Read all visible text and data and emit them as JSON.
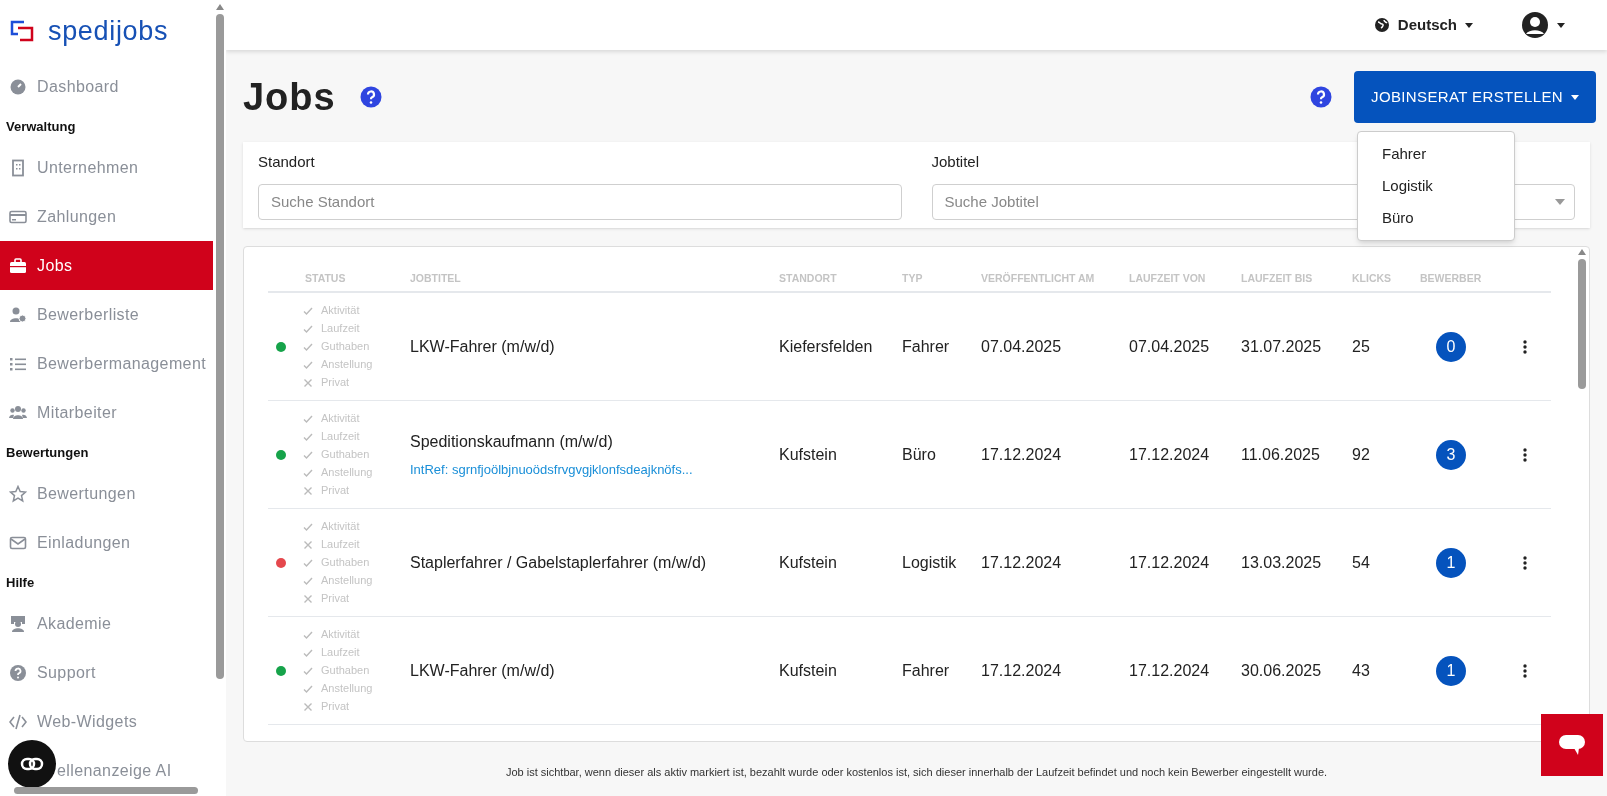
{
  "logo": {
    "text": "spedijobs"
  },
  "sidebar": {
    "items": [
      {
        "kind": "item",
        "label": "Dashboard",
        "selected": false
      },
      {
        "kind": "section",
        "label": "Verwaltung"
      },
      {
        "kind": "item",
        "label": "Unternehmen",
        "selected": false
      },
      {
        "kind": "item",
        "label": "Zahlungen",
        "selected": false
      },
      {
        "kind": "item",
        "label": "Jobs",
        "selected": true
      },
      {
        "kind": "item",
        "label": "Bewerberliste",
        "selected": false
      },
      {
        "kind": "item",
        "label": "Bewerbermanagement",
        "selected": false
      },
      {
        "kind": "item",
        "label": "Mitarbeiter",
        "selected": false
      },
      {
        "kind": "section",
        "label": "Bewertungen"
      },
      {
        "kind": "item",
        "label": "Bewertungen",
        "selected": false
      },
      {
        "kind": "item",
        "label": "Einladungen",
        "selected": false
      },
      {
        "kind": "section",
        "label": "Hilfe"
      },
      {
        "kind": "item",
        "label": "Akademie",
        "selected": false
      },
      {
        "kind": "item",
        "label": "Support",
        "selected": false
      },
      {
        "kind": "item",
        "label": "Web-Widgets",
        "selected": false
      },
      {
        "kind": "item",
        "label": "ellenanzeige AI",
        "selected": false
      }
    ]
  },
  "header": {
    "language": "Deutsch"
  },
  "page": {
    "title": "Jobs",
    "create_button": "JOBINSERAT ERSTELLEN",
    "dropdown": [
      "Fahrer",
      "Logistik",
      "Büro"
    ]
  },
  "filters": [
    {
      "label": "Standort",
      "placeholder": "Suche Standort",
      "kind": "text"
    },
    {
      "label": "Jobtitel",
      "placeholder": "Suche Jobtitel",
      "kind": "select"
    }
  ],
  "table": {
    "columns": [
      "STATUS",
      "JOBTITEL",
      "STANDORT",
      "TYP",
      "VERÖFFENTLICHT AM",
      "LAUFZEIT VON",
      "LAUFZEIT BIS",
      "KLICKS",
      "BEWERBER"
    ],
    "rows": [
      {
        "color": "#16a34a",
        "checks": [
          {
            "label": "Aktivität",
            "ok": true
          },
          {
            "label": "Laufzeit",
            "ok": true
          },
          {
            "label": "Guthaben",
            "ok": true
          },
          {
            "label": "Anstellung",
            "ok": true
          },
          {
            "label": "Privat",
            "ok": false
          }
        ],
        "title": "LKW-Fahrer (m/w/d)",
        "standort": "Kiefersfelden",
        "typ": "Fahrer",
        "published": "07.04.2025",
        "from": "07.04.2025",
        "to": "31.07.2025",
        "clicks": "25",
        "applicants": "0"
      },
      {
        "color": "#16a34a",
        "checks": [
          {
            "label": "Aktivität",
            "ok": true
          },
          {
            "label": "Laufzeit",
            "ok": true
          },
          {
            "label": "Guthaben",
            "ok": true
          },
          {
            "label": "Anstellung",
            "ok": true
          },
          {
            "label": "Privat",
            "ok": false
          }
        ],
        "title": "Speditionskaufmann (m/w/d)",
        "intref": "IntRef: sgrnfjoölbjnuoödsfrvgvgjklonfsdeajknöfs...",
        "standort": "Kufstein",
        "typ": "Büro",
        "published": "17.12.2024",
        "from": "17.12.2024",
        "to": "11.06.2025",
        "clicks": "92",
        "applicants": "3"
      },
      {
        "color": "#e5484d",
        "checks": [
          {
            "label": "Aktivität",
            "ok": true
          },
          {
            "label": "Laufzeit",
            "ok": false
          },
          {
            "label": "Guthaben",
            "ok": true
          },
          {
            "label": "Anstellung",
            "ok": true
          },
          {
            "label": "Privat",
            "ok": false
          }
        ],
        "title": "Staplerfahrer / Gabelstaplerfahrer (m/w/d)",
        "standort": "Kufstein",
        "typ": "Logistik",
        "published": "17.12.2024",
        "from": "17.12.2024",
        "to": "13.03.2025",
        "clicks": "54",
        "applicants": "1"
      },
      {
        "color": "#16a34a",
        "checks": [
          {
            "label": "Aktivität",
            "ok": true
          },
          {
            "label": "Laufzeit",
            "ok": true
          },
          {
            "label": "Guthaben",
            "ok": true
          },
          {
            "label": "Anstellung",
            "ok": true
          },
          {
            "label": "Privat",
            "ok": false
          }
        ],
        "title": "LKW-Fahrer (m/w/d)",
        "standort": "Kufstein",
        "typ": "Fahrer",
        "published": "17.12.2024",
        "from": "17.12.2024",
        "to": "30.06.2025",
        "clicks": "43",
        "applicants": "1"
      }
    ]
  },
  "footer": "Job ist sichtbar, wenn dieser als aktiv markiert ist, bezahlt wurde oder kostenlos ist, sich dieser innerhalb der Laufzeit befindet und noch kein Bewerber eingestellt wurde."
}
